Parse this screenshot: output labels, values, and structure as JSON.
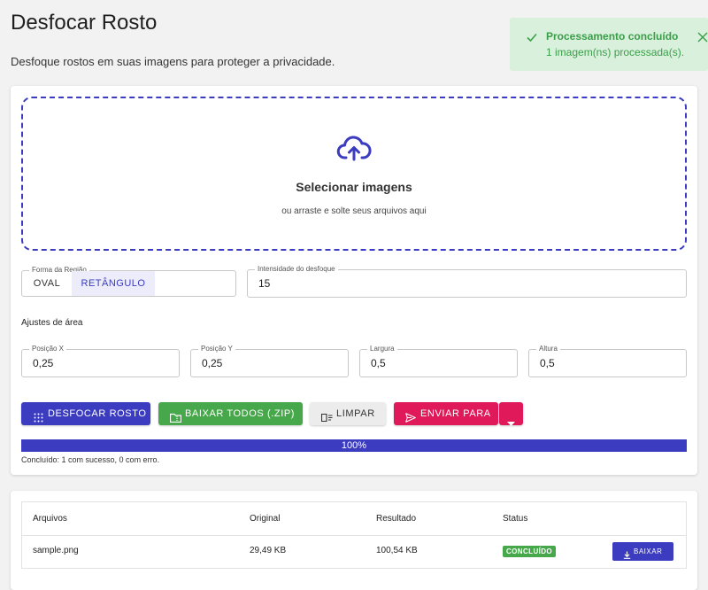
{
  "page": {
    "title": "Desfocar Rosto",
    "subtitle": "Desfoque rostos em suas imagens para proteger a privacidade."
  },
  "toast": {
    "title": "Processamento concluído",
    "message": "1 imagem(ns) processada(s).",
    "color": "#3a9e49",
    "icon": "check-icon"
  },
  "dropzone": {
    "title": "Selecionar imagens",
    "hint": "ou arraste e solte seus arquivos aqui",
    "icon": "cloud-upload-icon"
  },
  "region_shape": {
    "legend": "Forma da Região",
    "options": [
      "OVAL",
      "RETÂNGULO"
    ],
    "selected": "RETÂNGULO"
  },
  "intensity": {
    "label": "Intensidade do desfoque",
    "value": "15"
  },
  "area": {
    "label": "Ajustes de área",
    "pos_x": {
      "label": "Posição X",
      "value": "0,25"
    },
    "pos_y": {
      "label": "Posição Y",
      "value": "0,25"
    },
    "width": {
      "label": "Largura",
      "value": "0,5"
    },
    "height": {
      "label": "Altura",
      "value": "0,5"
    }
  },
  "actions": {
    "blur": "DESFOCAR ROSTO",
    "download_all": "BAIXAR TODOS (.ZIP)",
    "clear": "LIMPAR",
    "send_to": "ENVIAR PARA"
  },
  "progress": {
    "percent": 100,
    "label": "100%",
    "status": "Concluído: 1 com sucesso, 0 com erro."
  },
  "files_table": {
    "headers": [
      "Arquivos",
      "Original",
      "Resultado",
      "Status"
    ],
    "rows": [
      {
        "file": "sample.png",
        "original": "29,49 KB",
        "result": "100,54 KB",
        "status": "CONCLUÍDO",
        "action": "BAIXAR"
      }
    ]
  },
  "colors": {
    "primary": "#3b3cbf",
    "success": "#46a84a",
    "accent": "#e0195a"
  }
}
